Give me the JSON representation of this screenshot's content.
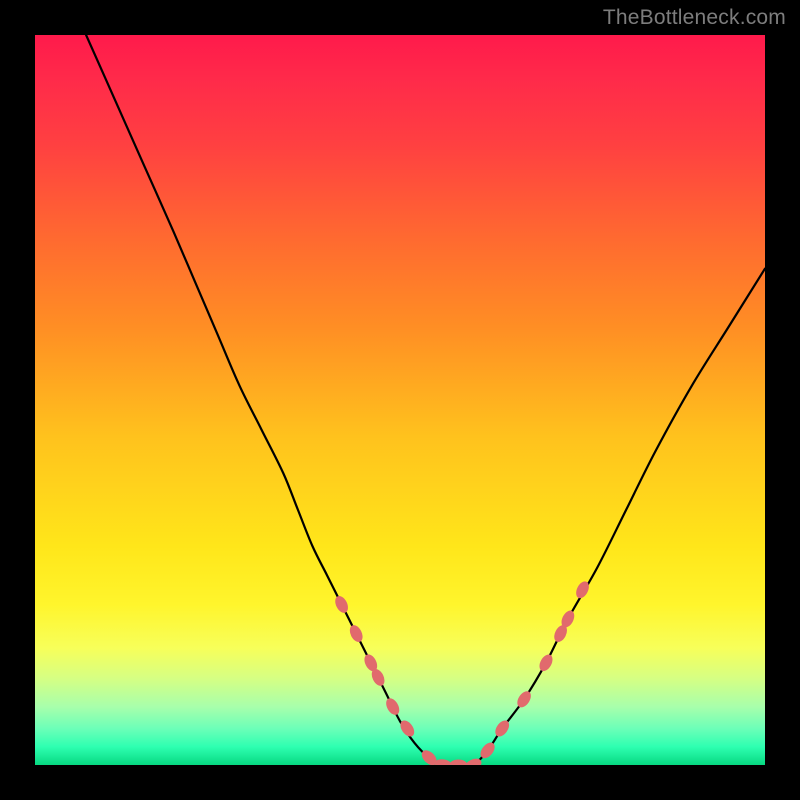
{
  "watermark": "TheBottleneck.com",
  "colors": {
    "background": "#000000",
    "watermark": "#7d7d7d",
    "curve": "#000000",
    "marker_fill": "#e16a6d",
    "marker_stroke": "#e16a6d",
    "gradient_stops": [
      {
        "offset": 0.0,
        "color": "#ff1a4b"
      },
      {
        "offset": 0.06,
        "color": "#ff2a4a"
      },
      {
        "offset": 0.15,
        "color": "#ff4041"
      },
      {
        "offset": 0.28,
        "color": "#ff6a30"
      },
      {
        "offset": 0.4,
        "color": "#ff8e24"
      },
      {
        "offset": 0.55,
        "color": "#ffc21d"
      },
      {
        "offset": 0.7,
        "color": "#ffe61a"
      },
      {
        "offset": 0.78,
        "color": "#fff52c"
      },
      {
        "offset": 0.84,
        "color": "#f7ff5a"
      },
      {
        "offset": 0.88,
        "color": "#d7ff82"
      },
      {
        "offset": 0.92,
        "color": "#a8ffab"
      },
      {
        "offset": 0.95,
        "color": "#6cffb8"
      },
      {
        "offset": 0.975,
        "color": "#2effb1"
      },
      {
        "offset": 1.0,
        "color": "#07d981"
      }
    ]
  },
  "chart_data": {
    "type": "line",
    "title": "",
    "xlabel": "",
    "ylabel": "",
    "xlim": [
      0,
      100
    ],
    "ylim": [
      0,
      100
    ],
    "grid": false,
    "legend": false,
    "series": [
      {
        "name": "bottleneck-curve",
        "x": [
          7,
          11,
          15,
          19,
          22,
          25,
          28,
          31,
          34,
          36,
          38,
          40,
          42,
          44,
          46,
          48,
          50,
          52,
          54,
          56,
          58,
          60,
          62,
          64,
          67,
          70,
          73,
          77,
          81,
          85,
          90,
          95,
          100
        ],
        "y": [
          100,
          91,
          82,
          73,
          66,
          59,
          52,
          46,
          40,
          35,
          30,
          26,
          22,
          18,
          14,
          10,
          6,
          3,
          1,
          0,
          0,
          0,
          2,
          5,
          9,
          14,
          20,
          27,
          35,
          43,
          52,
          60,
          68
        ]
      }
    ],
    "markers": {
      "name": "highlighted-points",
      "x": [
        42,
        44,
        46,
        47,
        49,
        51,
        54,
        56,
        58,
        60,
        62,
        64,
        67,
        70,
        72,
        73,
        75
      ],
      "y": [
        22,
        18,
        14,
        12,
        8,
        5,
        1,
        0,
        0,
        0,
        2,
        5,
        9,
        14,
        18,
        20,
        24
      ]
    }
  }
}
